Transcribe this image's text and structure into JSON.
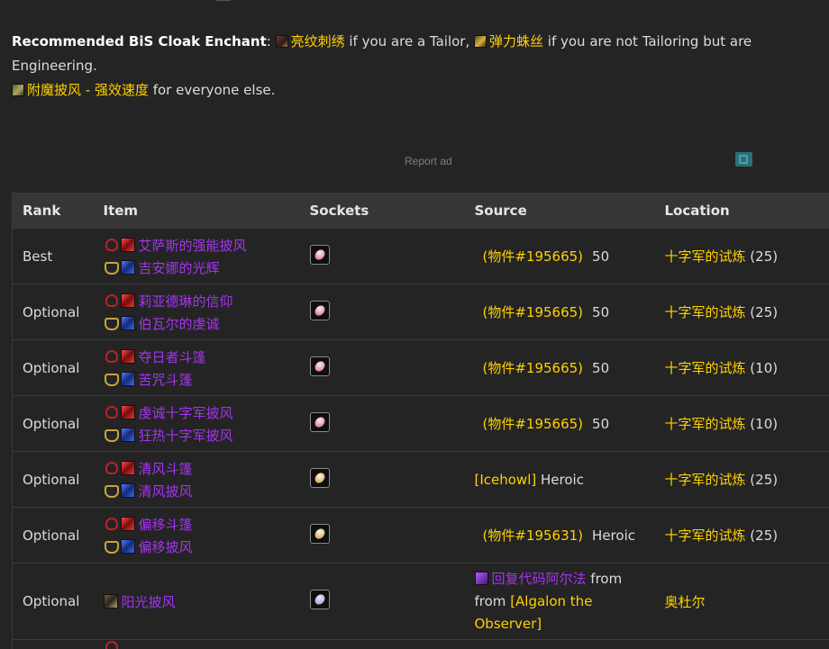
{
  "intro": {
    "lead": "Recommended BiS Cloak Enchant",
    "colon": ":",
    "link1": "亮纹刺绣",
    "text1": " if you are a Tailor, ",
    "link2": "弹力蛛丝",
    "text2": " if you are not Tailoring but are Engineering.",
    "link3": "附魔披风 - 强效速度",
    "text3": " for everyone else."
  },
  "ad": {
    "report_label": "Report ad"
  },
  "table": {
    "headers": [
      "Rank",
      "Item",
      "Sockets",
      "Source",
      "Location"
    ],
    "rows": [
      {
        "rank": "Best",
        "horde_item": "艾萨斯的强能披风",
        "alliance_item": "吉安娜的光辉",
        "source_token": "(物件#195665)",
        "source_val": "50",
        "location": "十字军的试炼",
        "location_size": "(25)"
      },
      {
        "rank": "Optional",
        "horde_item": "莉亚德琳的信仰",
        "alliance_item": "伯瓦尔的虔诚",
        "source_token": "(物件#195665)",
        "source_val": "50",
        "location": "十字军的试炼",
        "location_size": "(25)"
      },
      {
        "rank": "Optional",
        "horde_item": "夺日者斗篷",
        "alliance_item": "苦咒斗篷",
        "source_token": "(物件#195665)",
        "source_val": "50",
        "location": "十字军的试炼",
        "location_size": "(10)"
      },
      {
        "rank": "Optional",
        "horde_item": "虔诚十字军披风",
        "alliance_item": "狂热十字军披风",
        "source_token": "(物件#195665)",
        "source_val": "50",
        "location": "十字军的试炼",
        "location_size": "(10)"
      },
      {
        "rank": "Optional",
        "horde_item": "清风斗篷",
        "alliance_item": "清风披风",
        "source_boss": "[Icehowl]",
        "source_val": "Heroic",
        "location": "十字军的试炼",
        "location_size": "(25)"
      },
      {
        "rank": "Optional",
        "horde_item": "偏移斗篷",
        "alliance_item": "偏移披风",
        "source_token": "(物件#195631)",
        "source_val": "Heroic",
        "location": "十字军的试炼",
        "location_size": "(25)"
      },
      {
        "rank": "Optional",
        "single_item": "阳光披风",
        "source_ach": "回复代码阿尔法",
        "source_from1": " from",
        "source_from2": "from ",
        "source_boss": "[Algalon the Observer]",
        "location": "奥杜尔"
      }
    ]
  },
  "colors": {
    "epic": "#a335ee",
    "gold": "#ffd100",
    "bg": "#242424",
    "header_bg": "#363636"
  }
}
